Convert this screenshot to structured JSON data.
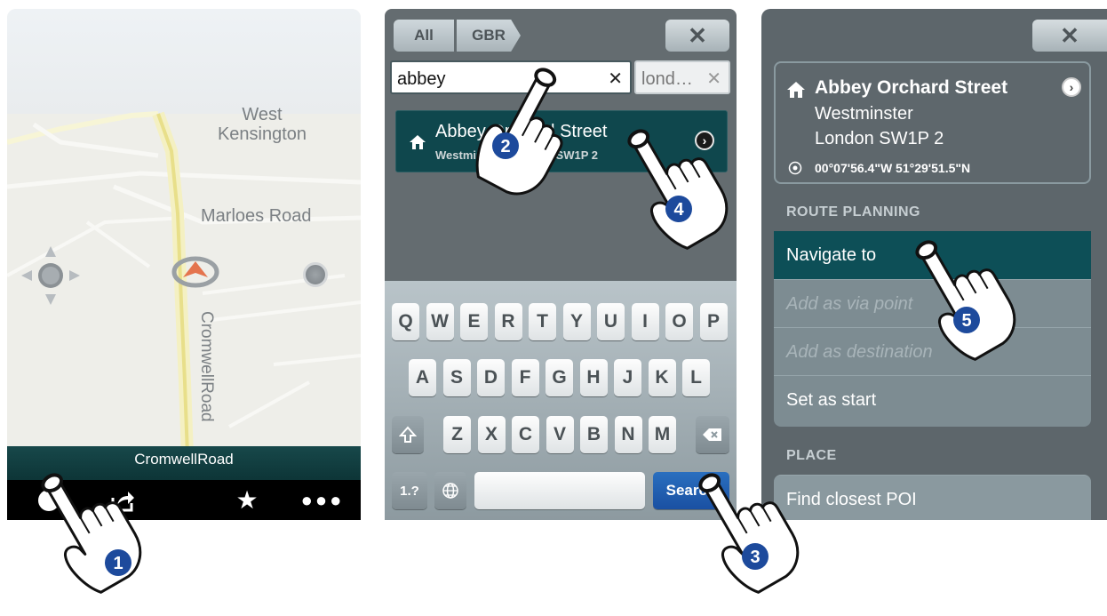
{
  "panel1": {
    "map_labels": {
      "area": "West\nKensington",
      "street1": "Marloes Road",
      "street2": "CromwellRoad"
    },
    "street_bar": "CromwellRoad",
    "toolbar_icons": [
      "menu-icon",
      "share-icon",
      "star-icon",
      "more-icon"
    ]
  },
  "panel2": {
    "tabs": [
      "All",
      "GBR"
    ],
    "close_glyph": "✕",
    "search_value": "abbey",
    "location_value": "lond…",
    "clear_glyph": "✕",
    "result": {
      "title": "Abbey Orchard Street",
      "subtitle": "Westminster, London SW1P 2"
    },
    "keyboard": {
      "row1": [
        "Q",
        "W",
        "E",
        "R",
        "T",
        "Y",
        "U",
        "I",
        "O",
        "P"
      ],
      "row2": [
        "A",
        "S",
        "D",
        "F",
        "G",
        "H",
        "J",
        "K",
        "L"
      ],
      "row3": [
        "Z",
        "X",
        "C",
        "V",
        "B",
        "N",
        "M"
      ],
      "num_key": "1.?",
      "search_key": "Search"
    }
  },
  "panel3": {
    "close_glyph": "✕",
    "place": {
      "name": "Abbey Orchard Street",
      "line1": "Westminster",
      "line2": "London SW1P 2",
      "coordinates": "00°07'56.4\"W  51°29'51.5\"N"
    },
    "route_section": "ROUTE PLANNING",
    "route_items": [
      "Navigate to",
      "Add as via point",
      "Add as destination",
      "Set as start"
    ],
    "place_section": "PLACE",
    "place_items": [
      "Find closest POI"
    ]
  },
  "steps": [
    "1",
    "2",
    "3",
    "4",
    "5"
  ]
}
